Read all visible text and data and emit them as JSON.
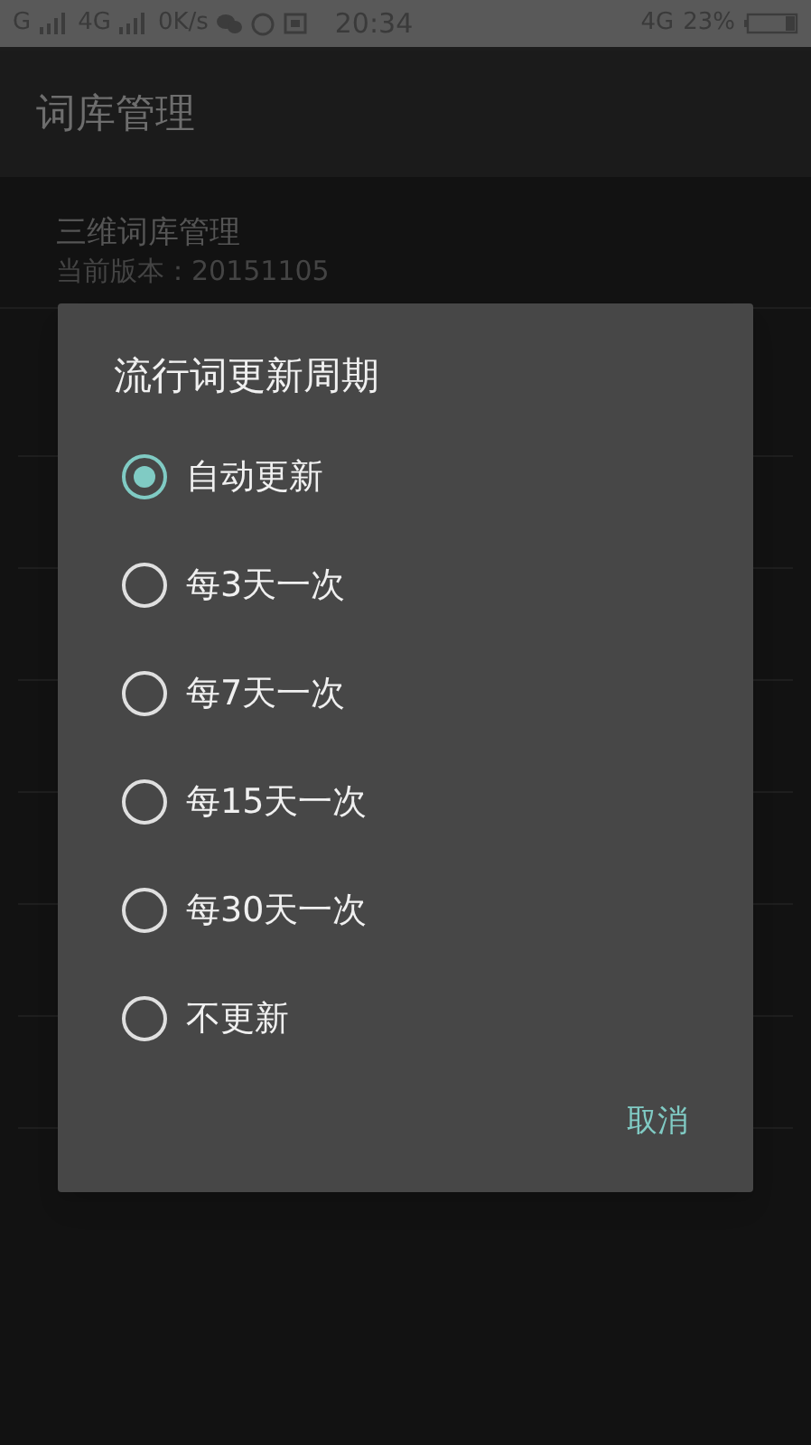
{
  "status_bar": {
    "carrier_1": "G",
    "carrier_2": "4G",
    "speed": "0K/s",
    "time": "20:34",
    "network": "4G",
    "battery": "23%"
  },
  "app_bar": {
    "title": "词库管理"
  },
  "list": [
    {
      "title": "三维词库管理",
      "subtitle": "当前版本：20151105"
    }
  ],
  "dialog": {
    "title": "流行词更新周期",
    "options": [
      {
        "label": "自动更新",
        "selected": true
      },
      {
        "label": "每3天一次",
        "selected": false
      },
      {
        "label": "每7天一次",
        "selected": false
      },
      {
        "label": "每15天一次",
        "selected": false
      },
      {
        "label": "每30天一次",
        "selected": false
      },
      {
        "label": "不更新",
        "selected": false
      }
    ],
    "cancel": "取消"
  }
}
